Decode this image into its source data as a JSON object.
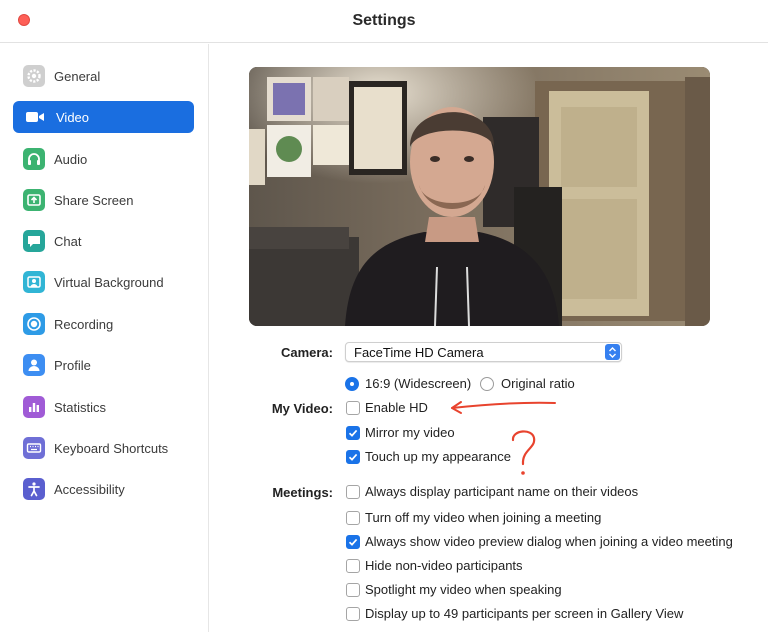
{
  "window": {
    "title": "Settings"
  },
  "sidebar": {
    "items": [
      {
        "label": "General",
        "icon": "gear-icon",
        "color": "#a0a0a0",
        "active": false
      },
      {
        "label": "Video",
        "icon": "video-camera-icon",
        "color": "#ffffff",
        "active": true
      },
      {
        "label": "Audio",
        "icon": "headphones-icon",
        "color": "#3cb371",
        "active": false
      },
      {
        "label": "Share Screen",
        "icon": "share-screen-icon",
        "color": "#3cb371",
        "active": false
      },
      {
        "label": "Chat",
        "icon": "chat-bubble-icon",
        "color": "#26a69a",
        "active": false
      },
      {
        "label": "Virtual Background",
        "icon": "virtual-background-icon",
        "color": "#31b5d5",
        "active": false
      },
      {
        "label": "Recording",
        "icon": "record-icon",
        "color": "#2e9be6",
        "active": false
      },
      {
        "label": "Profile",
        "icon": "person-icon",
        "color": "#3d8ef2",
        "active": false
      },
      {
        "label": "Statistics",
        "icon": "bar-chart-icon",
        "color": "#a05bd6",
        "active": false
      },
      {
        "label": "Keyboard Shortcuts",
        "icon": "keyboard-icon",
        "color": "#6f6fd6",
        "active": false
      },
      {
        "label": "Accessibility",
        "icon": "accessibility-icon",
        "color": "#5a5fcf",
        "active": false
      }
    ]
  },
  "video": {
    "camera_label": "Camera:",
    "camera_value": "FaceTime HD Camera",
    "my_video_label": "My Video:",
    "ratio_options": [
      {
        "label": "16:9 (Widescreen)",
        "selected": true
      },
      {
        "label": "Original ratio",
        "selected": false
      }
    ],
    "my_video_options": [
      {
        "label": "Enable HD",
        "checked": false
      },
      {
        "label": "Mirror my video",
        "checked": true
      },
      {
        "label": "Touch up my appearance",
        "checked": true
      }
    ],
    "meetings_label": "Meetings:",
    "meetings_options": [
      {
        "label": "Always display participant name on their videos",
        "checked": false
      },
      {
        "label": "Turn off my video when joining a meeting",
        "checked": false
      },
      {
        "label": "Always show video preview dialog when joining a video meeting",
        "checked": true
      },
      {
        "label": "Hide non-video participants",
        "checked": false
      },
      {
        "label": "Spotlight my video when speaking",
        "checked": false
      },
      {
        "label": "Display up to 49 participants per screen in Gallery View",
        "checked": false
      }
    ]
  },
  "colors": {
    "accent": "#1a6ee0",
    "close_button": "#fe5f57",
    "annotation": "#e8432e"
  }
}
